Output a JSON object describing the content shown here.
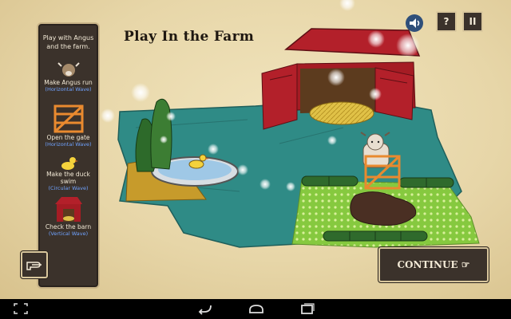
{
  "game": {
    "title": "Play In the Farm",
    "intro": "Play with Angus and the farm.",
    "continue_label": "CONTINUE ☞",
    "help_label": "?",
    "pause_label": "II"
  },
  "tasks": [
    {
      "label": "Make Angus run",
      "sub": "(Horizontal Wave)",
      "icon": "cow-icon"
    },
    {
      "label": "Open the gate",
      "sub": "(Horizontal Wave)",
      "icon": "gate-icon"
    },
    {
      "label": "Make the duck swim",
      "sub": "(Circular Wave)",
      "icon": "duck-icon"
    },
    {
      "label": "Check the barn",
      "sub": "(Vertical Wave)",
      "icon": "barn-icon"
    }
  ],
  "colors": {
    "panel": "#3b322b",
    "panel_border": "#d9c79d",
    "task_sub_text": "#6fa2ff",
    "teal_blanket": "#2f8b86",
    "barn_red": "#b3202a",
    "green_dots": "#86c93f"
  },
  "system_nav": {
    "icons": [
      "screenshot-icon",
      "back-icon",
      "home-icon",
      "recents-icon"
    ]
  }
}
